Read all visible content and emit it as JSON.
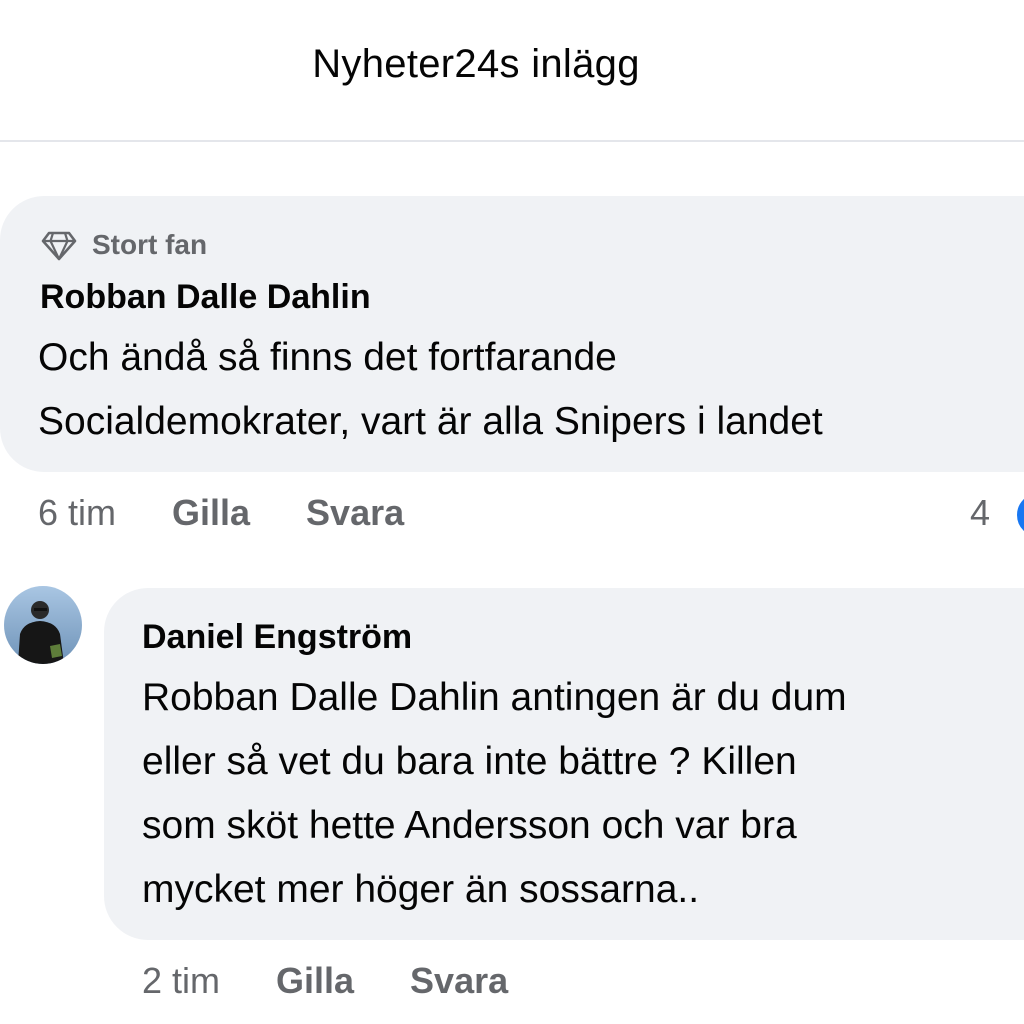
{
  "header": {
    "title": "Nyheter24s inlägg"
  },
  "comments": [
    {
      "badge": {
        "icon": "diamond-icon",
        "label": "Stort fan"
      },
      "author": "Robban Dalle Dahlin",
      "lines": [
        "Och ändå så finns det fortfarande",
        "Socialdemokrater, vart är alla Snipers i landet"
      ],
      "time": "6 tim",
      "like_label": "Gilla",
      "reply_label": "Svara",
      "reaction_count": "4"
    },
    {
      "avatar": {
        "icon": "user-avatar"
      },
      "author": "Daniel Engström",
      "lines": [
        "Robban Dalle Dahlin antingen är du dum",
        "eller så vet du bara inte bättre ? Killen",
        "som sköt hette Andersson och var bra",
        "mycket mer höger än sossarna.."
      ],
      "time": "2 tim",
      "like_label": "Gilla",
      "reply_label": "Svara"
    }
  ],
  "colors": {
    "bubble": "#f0f2f5",
    "secondary_text": "#65676b",
    "reaction_blue": "#1877f2"
  }
}
